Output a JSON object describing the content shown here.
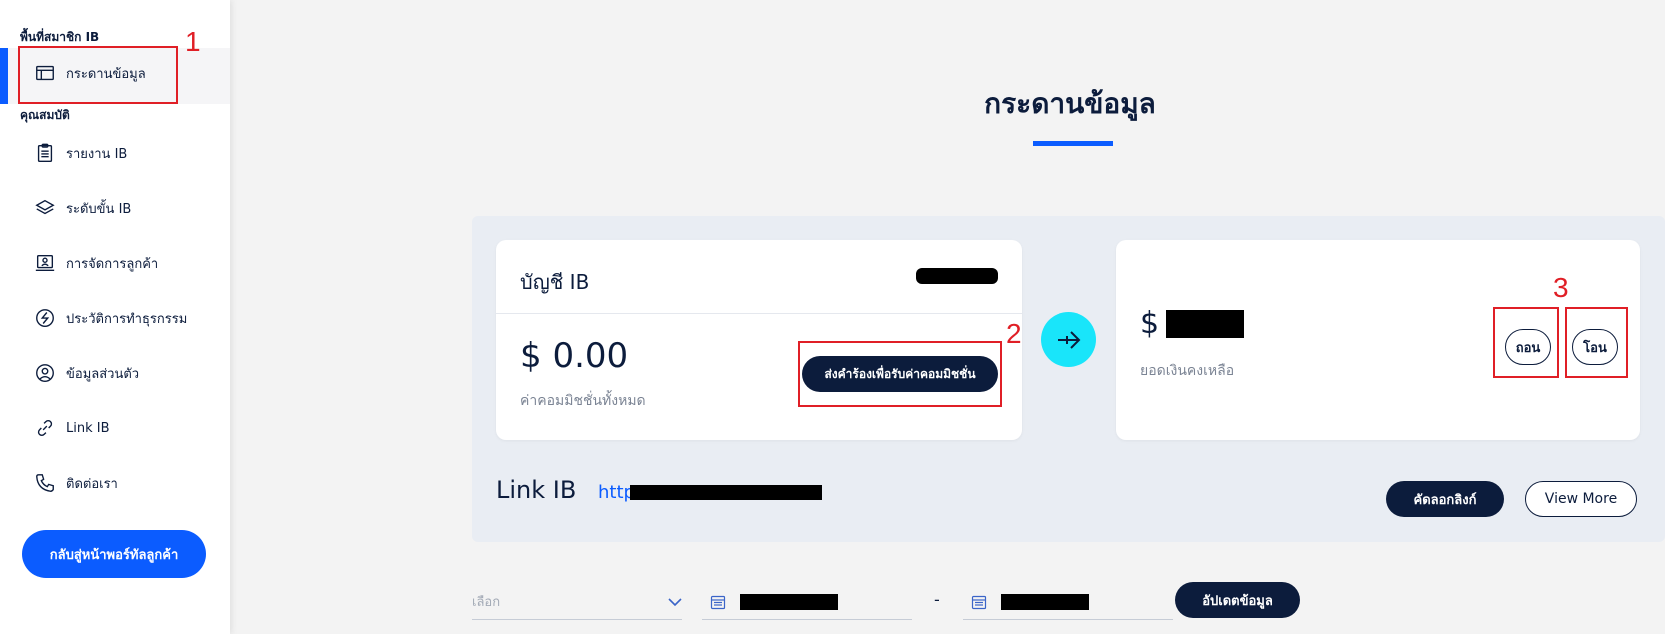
{
  "sidebar": {
    "section_member_area": "พื้นที่สมาชิก IB",
    "section_properties": "คุณสมบัติ",
    "items": [
      {
        "label": "กระดานข้อมูล",
        "icon": "dashboard-icon"
      },
      {
        "label": "รายงาน IB",
        "icon": "clipboard-icon"
      },
      {
        "label": "ระดับขั้น IB",
        "icon": "layers-icon"
      },
      {
        "label": "การจัดการลูกค้า",
        "icon": "monitor-user-icon"
      },
      {
        "label": "ประวัติการทำธุรกรรม",
        "icon": "transaction-icon"
      },
      {
        "label": "ข้อมูลส่วนตัว",
        "icon": "user-circle-icon"
      },
      {
        "label": "Link IB",
        "icon": "link-icon"
      },
      {
        "label": "ติดต่อเรา",
        "icon": "phone-icon"
      }
    ],
    "back_button": "กลับสู่หน้าพอร์ทัลลูกค้า"
  },
  "main": {
    "title": "กระดานข้อมูล",
    "ib_card": {
      "title": "บัญชี IB",
      "amount": "$ 0.00",
      "amount_caption": "ค่าคอมมิชชั่นทั้งหมด",
      "request_button": "ส่งคำร้องเพื่อรับค่าคอมมิชชั่น"
    },
    "balance_card": {
      "currency": "$",
      "caption": "ยอดเงินคงเหลือ",
      "withdraw_button": "ถอน",
      "transfer_button": "โอน"
    },
    "link": {
      "label": "Link IB",
      "url_visible": "http",
      "copy_button": "คัดลอกลิงก์",
      "more_button": "View More"
    },
    "filter": {
      "select_placeholder": "เลือก",
      "separator": "-",
      "update_button": "อัปเดตข้อมูล"
    }
  },
  "annotations": [
    "1",
    "2",
    "3"
  ],
  "colors": {
    "accent": "#0b5cff",
    "navy": "#0c1c3c",
    "cyan": "#19e5fa",
    "annotation_red": "#e01f26"
  }
}
